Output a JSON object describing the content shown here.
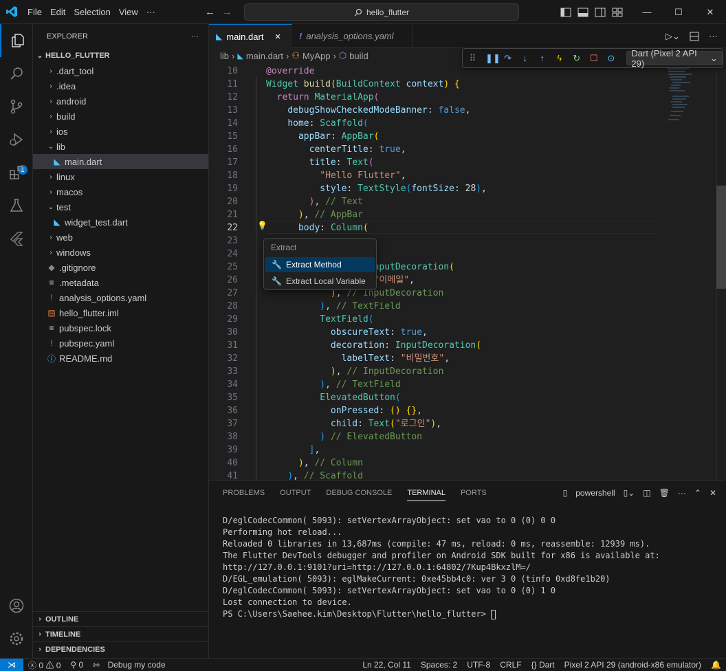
{
  "titlebar": {
    "menus": [
      "File",
      "Edit",
      "Selection",
      "View",
      "···"
    ],
    "search": "hello_flutter"
  },
  "explorer": {
    "title": "EXPLORER",
    "more": "···",
    "root": "HELLO_FLUTTER",
    "items": [
      {
        "label": ".dart_tool",
        "kind": "folder",
        "open": false
      },
      {
        "label": ".idea",
        "kind": "folder",
        "open": false
      },
      {
        "label": "android",
        "kind": "folder",
        "open": false
      },
      {
        "label": "build",
        "kind": "folder",
        "open": false
      },
      {
        "label": "ios",
        "kind": "folder",
        "open": false
      },
      {
        "label": "lib",
        "kind": "folder",
        "open": true
      },
      {
        "label": "main.dart",
        "kind": "dart",
        "selected": true
      },
      {
        "label": "linux",
        "kind": "folder",
        "open": false
      },
      {
        "label": "macos",
        "kind": "folder",
        "open": false
      },
      {
        "label": "test",
        "kind": "folder",
        "open": true
      },
      {
        "label": "widget_test.dart",
        "kind": "dart"
      },
      {
        "label": "web",
        "kind": "folder",
        "open": false
      },
      {
        "label": "windows",
        "kind": "folder",
        "open": false
      },
      {
        "label": ".gitignore",
        "kind": "git"
      },
      {
        "label": ".metadata",
        "kind": "lines"
      },
      {
        "label": "analysis_options.yaml",
        "kind": "yaml"
      },
      {
        "label": "hello_flutter.iml",
        "kind": "iml"
      },
      {
        "label": "pubspec.lock",
        "kind": "lines"
      },
      {
        "label": "pubspec.yaml",
        "kind": "yaml"
      },
      {
        "label": "README.md",
        "kind": "info"
      }
    ],
    "sections": [
      "OUTLINE",
      "TIMELINE",
      "DEPENDENCIES"
    ]
  },
  "activity": {
    "debug_badge": "1"
  },
  "tabs": [
    {
      "label": "main.dart",
      "active": true,
      "close": "✕"
    },
    {
      "label": "analysis_options.yaml",
      "active": false
    }
  ],
  "breadcrumb": [
    "lib",
    "main.dart",
    "MyApp",
    "build"
  ],
  "debug_toolbar": {
    "target": "Dart (Pixel 2 API 29)"
  },
  "code": [
    {
      "n": "10",
      "html": "<span class='an'>@override</span>"
    },
    {
      "n": "11",
      "html": "<span class='cls'>Widget</span> <span class='fn'>build</span><span class='b1'>(</span><span class='cls'>BuildContext</span> <span class='prop'>context</span><span class='b1'>)</span> <span class='b1'>{</span>"
    },
    {
      "n": "12",
      "html": "  <span class='an'>return</span> <span class='cls'>MaterialApp</span><span class='b2'>(</span>"
    },
    {
      "n": "13",
      "html": "    <span class='prop'>debugShowCheckedModeBanner</span>: <span class='kw'>false</span>,"
    },
    {
      "n": "14",
      "html": "    <span class='prop'>home</span>: <span class='cls'>Scaffold</span><span class='b3'>(</span>"
    },
    {
      "n": "15",
      "html": "      <span class='prop'>appBar</span>: <span class='cls'>AppBar</span><span class='b1'>(</span>"
    },
    {
      "n": "16",
      "html": "        <span class='prop'>centerTitle</span>: <span class='kw'>true</span>,"
    },
    {
      "n": "17",
      "html": "        <span class='prop'>title</span>: <span class='cls'>Text</span><span class='b2'>(</span>"
    },
    {
      "n": "18",
      "html": "          <span class='str'>\"Hello Flutter\"</span>,"
    },
    {
      "n": "19",
      "html": "          <span class='prop'>style</span>: <span class='cls'>TextStyle</span><span class='b3'>(</span><span class='prop'>fontSize</span>: <span class='wh'>28</span><span class='b3'>)</span>,"
    },
    {
      "n": "20",
      "html": "        <span class='b2'>)</span>, <span class='cm'>// Text</span>"
    },
    {
      "n": "21",
      "html": "      <span class='b1'>)</span>, <span class='cm'>// AppBar</span>"
    },
    {
      "n": "22",
      "html": "      <span class='prop'>body</span>: <span class='cls'>Column</span><span class='b1'>(</span>",
      "current": true
    },
    {
      "n": "23",
      "html": ""
    },
    {
      "n": "24",
      "html": ""
    },
    {
      "n": "25",
      "html": "                <span class='prop'>n</span>: <span class='cls'>InputDecoration</span><span class='b1'>(</span>"
    },
    {
      "n": "26",
      "html": "                <span class='prop'>xt</span>: <span class='str'>\"이메일\"</span>,"
    },
    {
      "n": "27",
      "html": "            <span class='b1'>)</span>, <span class='cm'>// InputDecoration</span>"
    },
    {
      "n": "28",
      "html": "          <span class='b3'>)</span>, <span class='cm'>// TextField</span>"
    },
    {
      "n": "29",
      "html": "          <span class='cls'>TextField</span><span class='b3'>(</span>"
    },
    {
      "n": "30",
      "html": "            <span class='prop'>obscureText</span>: <span class='kw'>true</span>,"
    },
    {
      "n": "31",
      "html": "            <span class='prop'>decoration</span>: <span class='cls'>InputDecoration</span><span class='b1'>(</span>"
    },
    {
      "n": "32",
      "html": "              <span class='prop'>labelText</span>: <span class='str'>\"비밀번호\"</span>,"
    },
    {
      "n": "33",
      "html": "            <span class='b1'>)</span>, <span class='cm'>// InputDecoration</span>"
    },
    {
      "n": "34",
      "html": "          <span class='b3'>)</span>, <span class='cm'>// TextField</span>"
    },
    {
      "n": "35",
      "html": "          <span class='cls'>ElevatedButton</span><span class='b3'>(</span>"
    },
    {
      "n": "36",
      "html": "            <span class='prop'>onPressed</span>: <span class='b1'>()</span> <span class='b1'>{}</span>,"
    },
    {
      "n": "37",
      "html": "            <span class='prop'>child</span>: <span class='cls'>Text</span><span class='b1'>(</span><span class='str'>\"로그인\"</span><span class='b1'>)</span>,"
    },
    {
      "n": "38",
      "html": "          <span class='b3'>)</span> <span class='cm'>// ElevatedButton</span>"
    },
    {
      "n": "39",
      "html": "        <span class='b3'>]</span>,"
    },
    {
      "n": "40",
      "html": "      <span class='b1'>)</span>, <span class='cm'>// Column</span>"
    },
    {
      "n": "41",
      "html": "    <span class='b3'>)</span>, <span class='cm'>// Scaffold</span>"
    }
  ],
  "popup": {
    "title": "Extract",
    "items": [
      "Extract Method",
      "Extract Local Variable"
    ]
  },
  "panel": {
    "tabs": [
      "PROBLEMS",
      "OUTPUT",
      "DEBUG CONSOLE",
      "TERMINAL",
      "PORTS"
    ],
    "active_tab": "TERMINAL",
    "shell": "powershell",
    "terminal_lines": [
      "D/eglCodecCommon( 5093): setVertexArrayObject: set vao to 0 (0) 0 0",
      "Performing hot reload...",
      "Reloaded 0 libraries in 13,687ms (compile: 47 ms, reload: 0 ms, reassemble: 12939 ms).",
      "The Flutter DevTools debugger and profiler on Android SDK built for x86 is available at:",
      "http://127.0.0.1:9101?uri=http://127.0.0.1:64802/7Kup4BkxzlM=/",
      "D/EGL_emulation( 5093): eglMakeCurrent: 0xe45bb4c0: ver 3 0 (tinfo 0xd8fe1b20)",
      "D/eglCodecCommon( 5093): setVertexArrayObject: set vao to 0 (0) 1 0",
      "Lost connection to device."
    ],
    "prompt": "PS C:\\Users\\Saehee.kim\\Desktop\\Flutter\\hello_flutter> "
  },
  "status": {
    "errors": "0",
    "warnings": "0",
    "ports": "0",
    "debug": "Debug my code",
    "position": "Ln 22, Col 11",
    "spaces": "Spaces: 2",
    "encoding": "UTF-8",
    "eol": "CRLF",
    "language": "Dart",
    "device": "Pixel 2 API 29 (android-x86 emulator)"
  },
  "colors": {
    "accent": "#0078d4",
    "bg": "#1f1f1f",
    "sidebar": "#181818"
  }
}
